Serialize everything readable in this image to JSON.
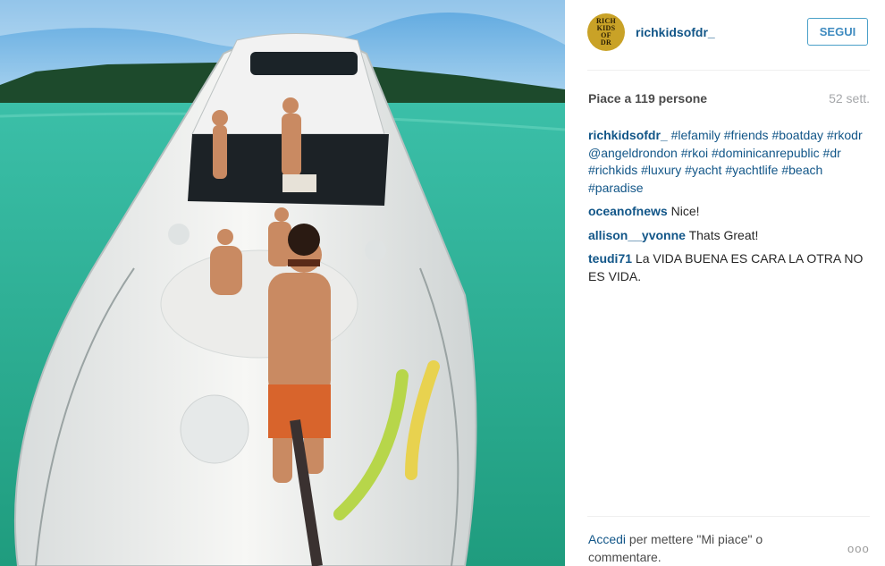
{
  "photo": {
    "description_icon": "yacht-selfie-photo"
  },
  "header": {
    "avatar_lines": [
      "RICH",
      "KIDS",
      "OF",
      "DR"
    ],
    "username": "richkidsofdr_",
    "follow_label": "SEGUI"
  },
  "stats": {
    "likes": "Piace a 119 persone",
    "time": "52 sett."
  },
  "caption": {
    "user": "richkidsofdr_",
    "hashtags": [
      "#lefamily",
      "#friends",
      "#boatday",
      "#rkodr",
      "@angeldrondon",
      "#rkoi",
      "#dominicanrepublic",
      "#dr",
      "#richkids",
      "#luxury",
      "#yacht",
      "#yachtlife",
      "#beach",
      "#paradise"
    ]
  },
  "comments": [
    {
      "user": "oceanofnews",
      "text": "Nice!"
    },
    {
      "user": "allison__yvonne",
      "text": "Thats Great!"
    },
    {
      "user": "teudi71",
      "text": "La VIDA BUENA ES CARA LA OTRA NO ES VIDA."
    }
  ],
  "footer": {
    "login_link": "Accedi",
    "login_text": "per mettere \"Mi piace\" o commentare.",
    "more_label": "ooo"
  },
  "colors": {
    "link": "#125688",
    "follow_border": "#4aa0c8",
    "avatar_gold": "#c9a227"
  }
}
